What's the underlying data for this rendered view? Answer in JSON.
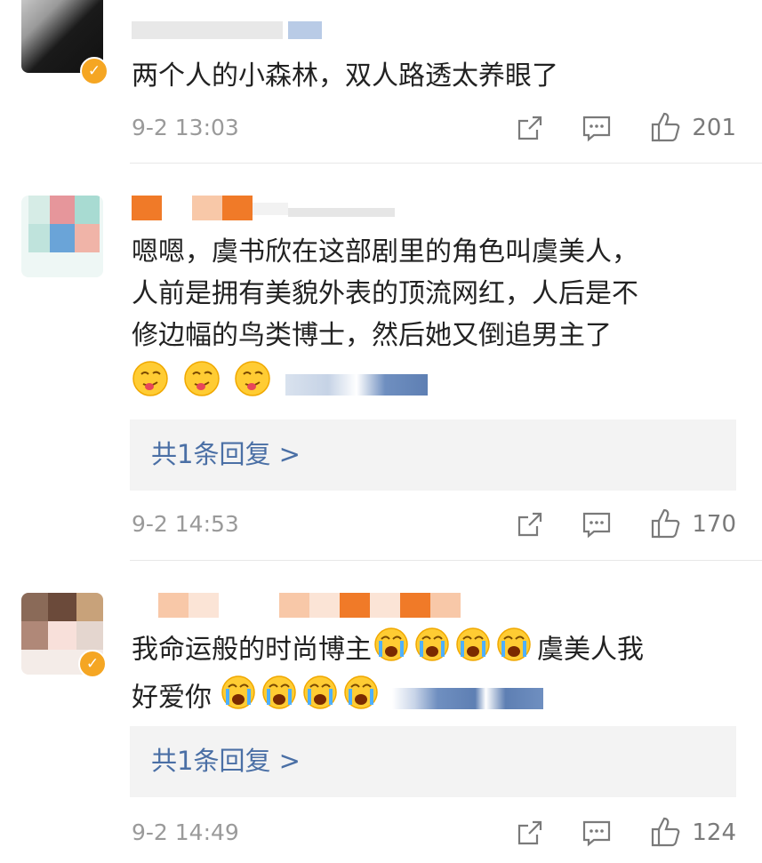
{
  "comments": [
    {
      "text": "两个人的小森林，双人路透太养眼了",
      "time": "9-2 13:03",
      "likes": "201",
      "avatar_colors": [
        "#222222",
        "#dcdcdc"
      ],
      "verified": true
    },
    {
      "text_lines": [
        "嗯嗯，虞书欣在这部剧里的角色叫虞美人，",
        "人前是拥有美貌外表的顶流网红，人后是不",
        "修边幅的鸟类博士，然后她又倒追男主了"
      ],
      "emoji": [
        "tongue-emoji",
        "tongue-emoji",
        "tongue-emoji"
      ],
      "reply_label": "共1条回复 >",
      "time": "9-2 14:53",
      "likes": "170",
      "avatar_colors": [
        "#e6969b",
        "#9ad2c8",
        "#6aa4d8",
        "#f0b4a8"
      ],
      "verified": false
    },
    {
      "text_lines": [
        "我命运般的时尚博主",
        "好爱你"
      ],
      "line1_tail": "虞美人我",
      "emoji_line1": [
        "crying-emoji",
        "crying-emoji",
        "crying-emoji",
        "crying-emoji"
      ],
      "emoji_line2": [
        "crying-emoji",
        "crying-emoji",
        "crying-emoji",
        "crying-emoji"
      ],
      "reply_label": "共1条回复 >",
      "time": "9-2 14:49",
      "likes": "124",
      "avatar_colors": [
        "#6b4a3a",
        "#c89a8a",
        "#f5a623"
      ],
      "verified": true
    }
  ],
  "colors": {
    "reply_link": "#4a6fa5",
    "meta_text": "#9a9a9a",
    "badge": "#f5a623",
    "reply_bg": "#f3f3f3"
  },
  "icons": [
    "share-icon",
    "comment-icon",
    "like-icon"
  ]
}
